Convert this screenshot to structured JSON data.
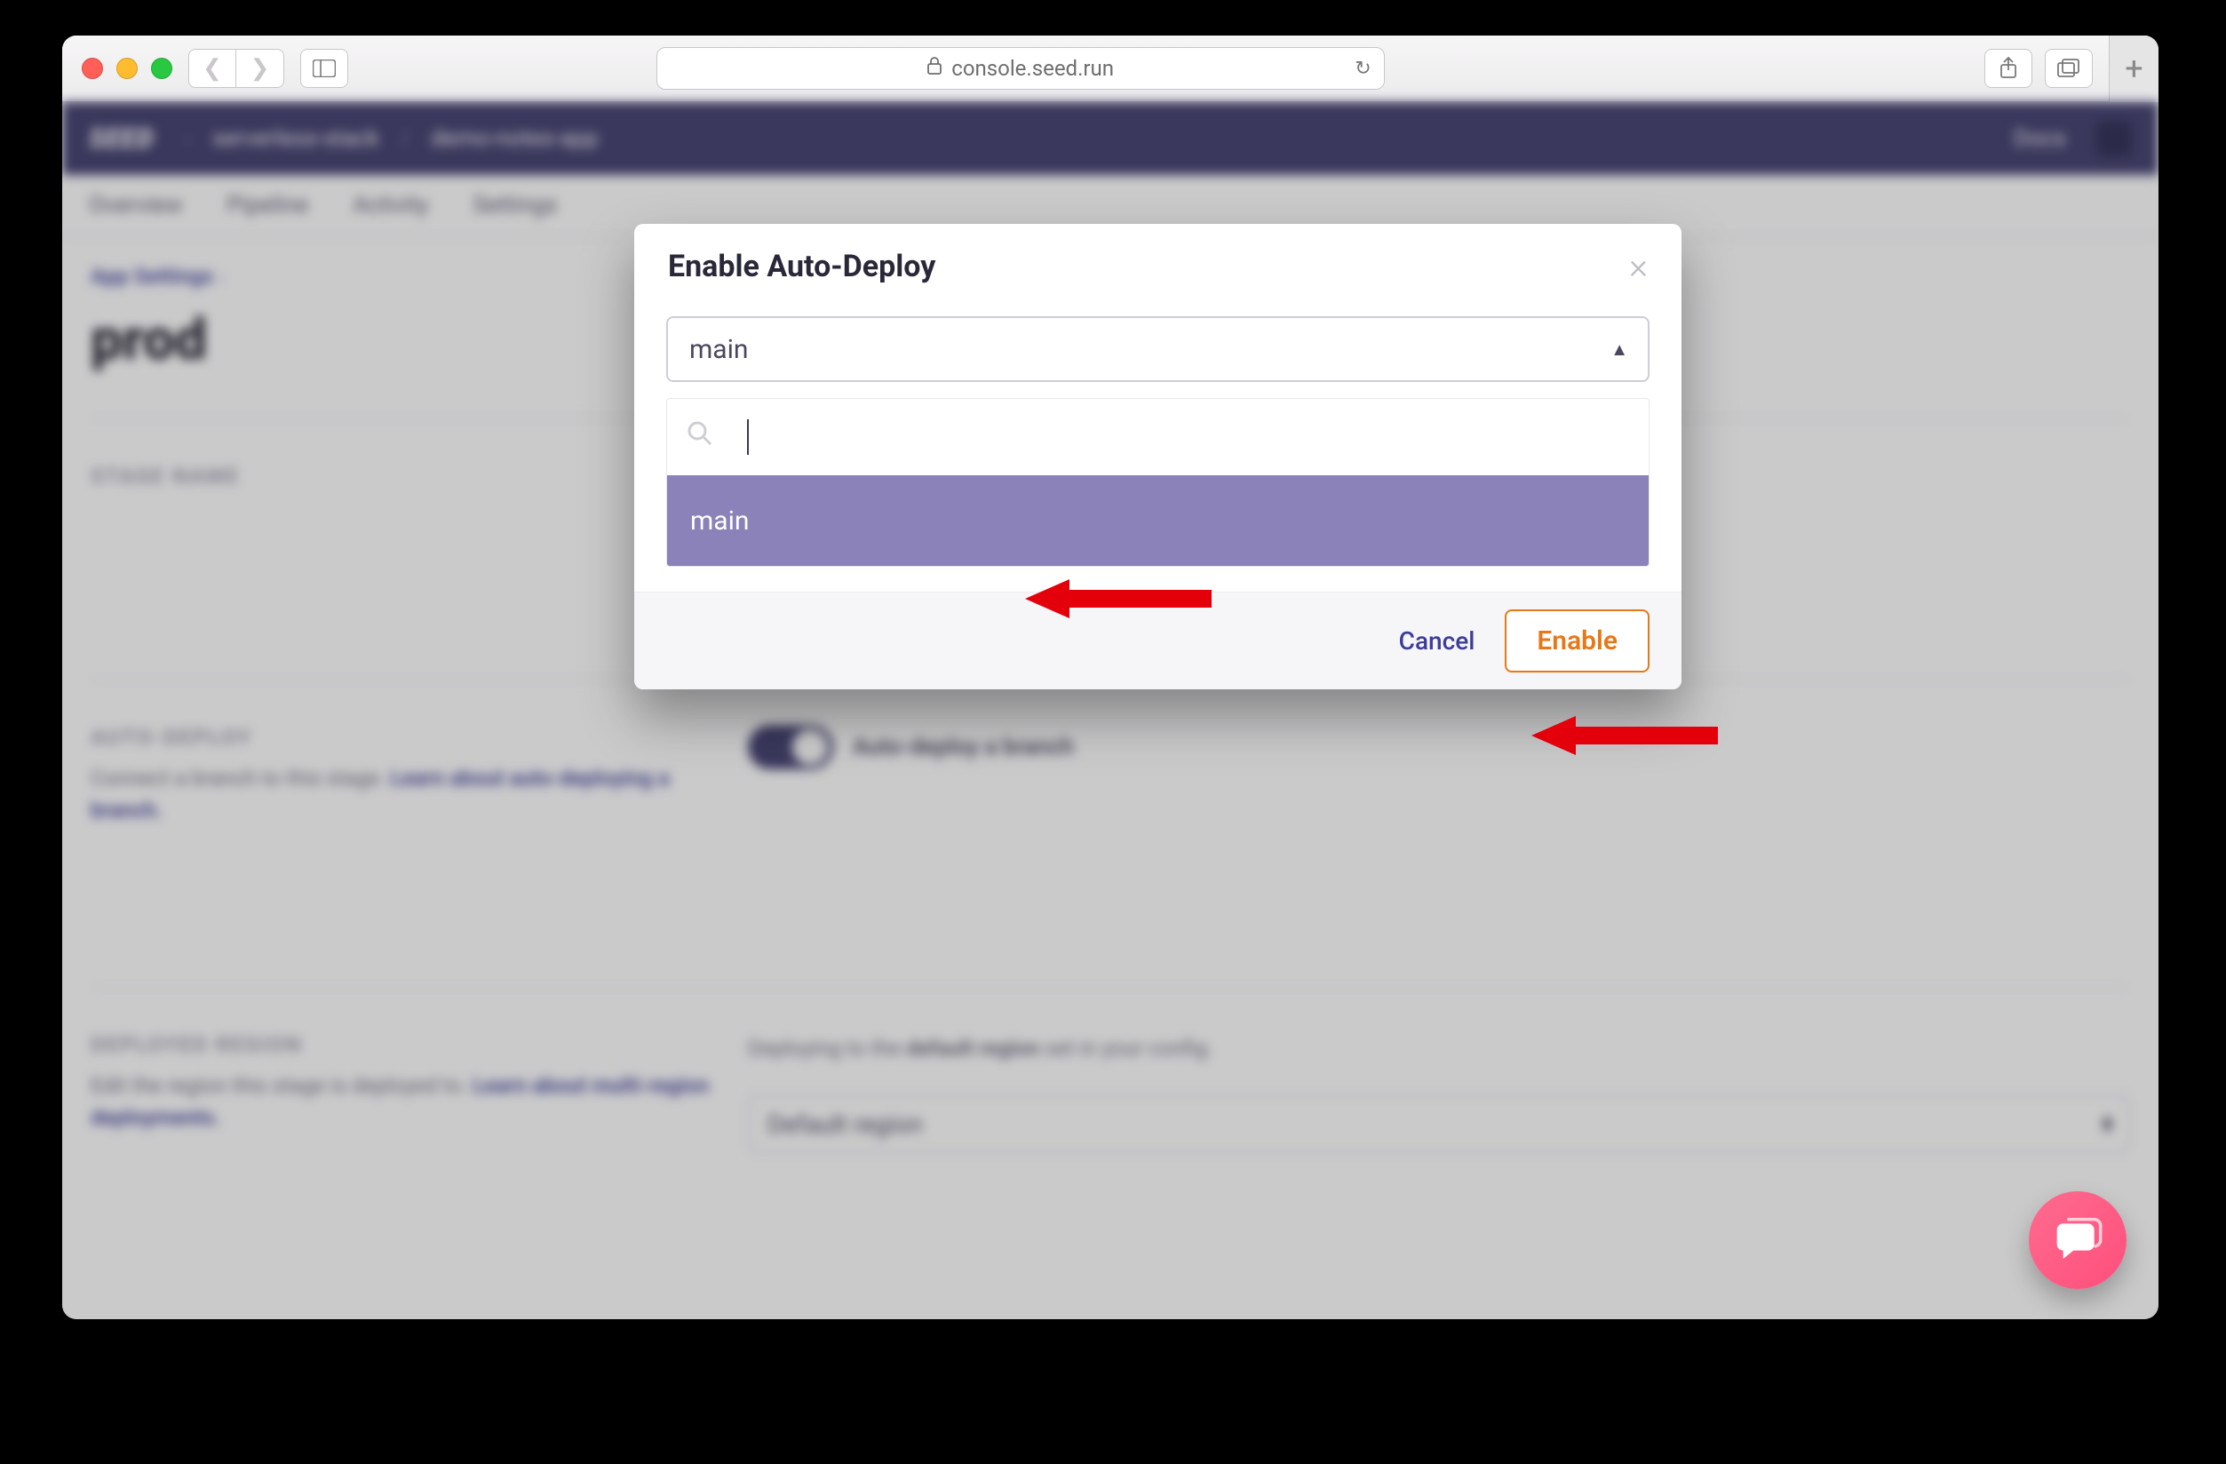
{
  "browser": {
    "url_host": "console.seed.run"
  },
  "header": {
    "brand": "SEED",
    "crumb_org": "serverless-stack",
    "crumb_app": "demo-notes-app",
    "docs_label": "Docs"
  },
  "subnav": {
    "items": [
      "Overview",
      "Pipeline",
      "Activity",
      "Settings"
    ]
  },
  "page": {
    "breadcrumb": "App Settings",
    "title": "prod",
    "stage_name_label": "STAGE NAME",
    "auto_deploy": {
      "label": "AUTO-DEPLOY",
      "desc_prefix": "Connect a branch to this stage. ",
      "desc_link": "Learn about auto-deploying a branch.",
      "toggle_label": "Auto-deploy a branch"
    },
    "region": {
      "label": "DEPLOYED REGION",
      "desc_prefix": "Edit the region this stage is deployed to. ",
      "desc_link": "Learn about multi-region deployments.",
      "notice_prefix": "Deploying to the ",
      "notice_bold": "default region",
      "notice_suffix": " set in your config.",
      "select_value": "Default region"
    }
  },
  "modal": {
    "title": "Enable Auto-Deploy",
    "selected": "main",
    "search_placeholder": "",
    "options": [
      "main"
    ],
    "cancel_label": "Cancel",
    "enable_label": "Enable"
  }
}
